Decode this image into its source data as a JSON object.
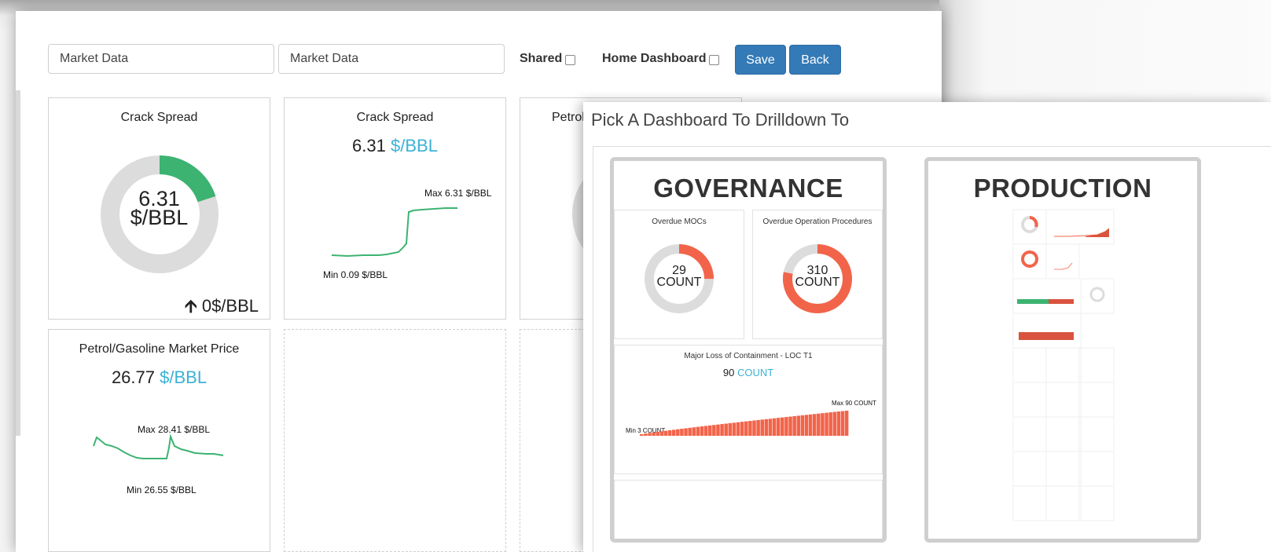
{
  "toolbar": {
    "name_input_value": "Market Data",
    "desc_input_value": "Market Data",
    "shared_label": "Shared",
    "home_dashboard_label": "Home Dashboard",
    "save_label": "Save",
    "back_label": "Back"
  },
  "widgets": {
    "crack_gauge": {
      "title": "Crack Spread",
      "value": "6.31",
      "unit": "$/BBL",
      "change": "0$/BBL",
      "fraction": 0.2,
      "color": "#3cb371"
    },
    "crack_spark": {
      "title": "Crack Spread",
      "value": "6.31",
      "unit": "$/BBL",
      "max_label": "Max 6.31 $/BBL",
      "min_label": "Min 0.09 $/BBL"
    },
    "petrol_partial": {
      "title_visible": "Petrol"
    },
    "petrol_spark": {
      "title": "Petrol/Gasoline Market Price",
      "value": "26.77",
      "unit": "$/BBL",
      "max_label": "Max 28.41 $/BBL",
      "min_label": "Min 26.55 $/BBL"
    }
  },
  "modal": {
    "title": "Pick A Dashboard To Drilldown To",
    "cards": [
      {
        "title": "GOVERNANCE",
        "widgets": {
          "overdue_mocs": {
            "title": "Overdue MOCs",
            "value": "29",
            "unit": "COUNT",
            "fraction": 0.25
          },
          "overdue_ops": {
            "title": "Overdue Operation Procedures",
            "value": "310",
            "unit": "COUNT",
            "fraction": 0.78
          },
          "loc": {
            "title": "Major Loss of Containment - LOC T1",
            "value": "90",
            "unit": "COUNT",
            "max_label": "Max 90 COUNT",
            "min_label": "Min 3 COUNT"
          }
        }
      },
      {
        "title": "PRODUCTION"
      }
    ]
  },
  "colors": {
    "accent": "#337ab7",
    "unit_blue": "#3bb2d6",
    "gauge_bg": "#dcdcdc",
    "green": "#3cb371",
    "red_orange": "#f2644a"
  }
}
